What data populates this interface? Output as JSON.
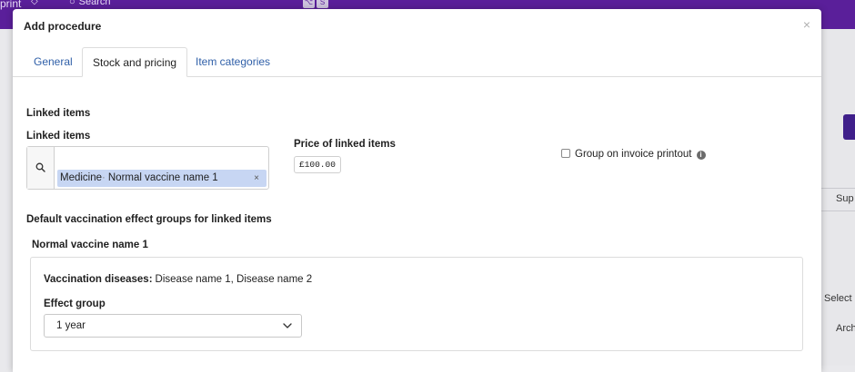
{
  "background": {
    "brand": "print",
    "search_placeholder": "Search",
    "kbd": [
      "⌥",
      "S"
    ],
    "right_texts": [
      "Sup",
      "Select",
      "Arch"
    ]
  },
  "modal": {
    "title": "Add procedure",
    "close": "×",
    "tabs": [
      {
        "label": "General",
        "active": false
      },
      {
        "label": "Stock and pricing",
        "active": true
      },
      {
        "label": "Item categories",
        "active": false
      }
    ]
  },
  "linked": {
    "section_title": "Linked items",
    "field_label": "Linked items",
    "chip_type": "Medicine",
    "chip_name": "Normal vaccine name 1",
    "chip_remove": "×",
    "price_label": "Price of linked items",
    "price_value": "£100.00",
    "group_checkbox_label": "Group on invoice printout",
    "group_checked": false
  },
  "vaccination": {
    "section_title": "Default vaccination effect groups for linked items",
    "vaccine_name": "Normal vaccine name 1",
    "diseases_label": "Vaccination diseases:",
    "diseases_value": "Disease name 1, Disease name 2",
    "effect_group_label": "Effect group",
    "effect_group_value": "1 year"
  },
  "colors": {
    "topbar": "#5a1f9a",
    "tab_link": "#2f5fa8",
    "chip_bg": "#c7d6f3"
  }
}
